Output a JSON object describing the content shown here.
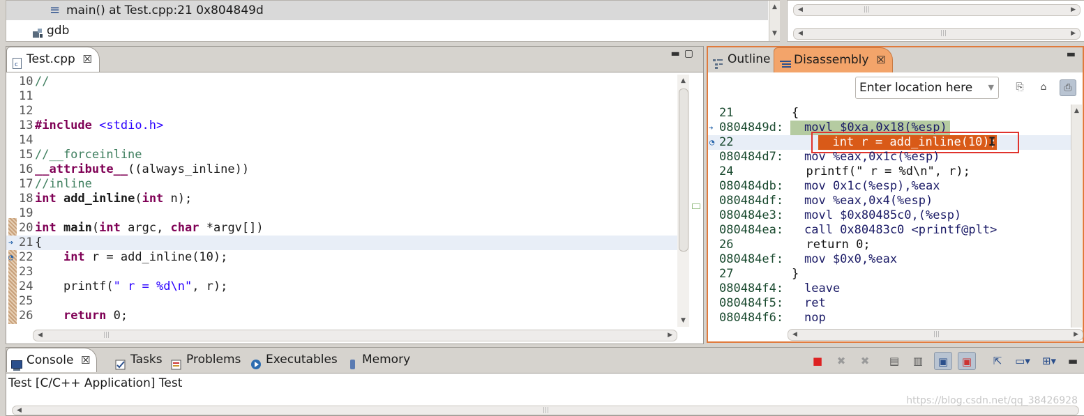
{
  "debug": {
    "stack_frame": "main() at Test.cpp:21 0x804849d",
    "process": "gdb"
  },
  "editor": {
    "tab_label": "Test.cpp",
    "lines": [
      {
        "num": "10",
        "segs": [
          {
            "t": "//",
            "c": "cm"
          }
        ]
      },
      {
        "num": "11",
        "segs": []
      },
      {
        "num": "12",
        "segs": []
      },
      {
        "num": "13",
        "segs": [
          {
            "t": "#include",
            "c": "pp"
          },
          {
            "t": " ",
            "c": ""
          },
          {
            "t": "<stdio.h>",
            "c": "inc"
          }
        ]
      },
      {
        "num": "14",
        "segs": []
      },
      {
        "num": "15",
        "segs": [
          {
            "t": "//__forceinline",
            "c": "cm"
          }
        ]
      },
      {
        "num": "16",
        "segs": [
          {
            "t": "__attribute__",
            "c": "kw"
          },
          {
            "t": "((always_inline))",
            "c": ""
          }
        ]
      },
      {
        "num": "17",
        "segs": [
          {
            "t": "//inline",
            "c": "cm"
          }
        ]
      },
      {
        "num": "18",
        "segs": [
          {
            "t": "int",
            "c": "kw"
          },
          {
            "t": " ",
            "c": ""
          },
          {
            "t": "add_inline",
            "c": "b"
          },
          {
            "t": "(",
            "c": ""
          },
          {
            "t": "int",
            "c": "kw"
          },
          {
            "t": " n);",
            "c": ""
          }
        ]
      },
      {
        "num": "19",
        "segs": []
      },
      {
        "num": "20",
        "segs": [
          {
            "t": "int",
            "c": "kw"
          },
          {
            "t": " ",
            "c": ""
          },
          {
            "t": "main",
            "c": "b"
          },
          {
            "t": "(",
            "c": ""
          },
          {
            "t": "int",
            "c": "kw"
          },
          {
            "t": " argc, ",
            "c": ""
          },
          {
            "t": "char",
            "c": "kw"
          },
          {
            "t": " *argv[])",
            "c": ""
          }
        ]
      },
      {
        "num": "21",
        "segs": [
          {
            "t": "{",
            "c": ""
          }
        ],
        "hl": true
      },
      {
        "num": "22",
        "segs": [
          {
            "t": "    ",
            "c": ""
          },
          {
            "t": "int",
            "c": "kw"
          },
          {
            "t": " r = add_inline(10);",
            "c": ""
          }
        ]
      },
      {
        "num": "23",
        "segs": []
      },
      {
        "num": "24",
        "segs": [
          {
            "t": "    printf(",
            "c": ""
          },
          {
            "t": "\" r = %d\\n\"",
            "c": "str"
          },
          {
            "t": ", r);",
            "c": ""
          }
        ]
      },
      {
        "num": "25",
        "segs": []
      },
      {
        "num": "26",
        "segs": [
          {
            "t": "    ",
            "c": ""
          },
          {
            "t": "return",
            "c": "kw"
          },
          {
            "t": " 0;",
            "c": ""
          }
        ]
      }
    ]
  },
  "disassembly": {
    "tabs": [
      "Outline",
      "Disassembly"
    ],
    "location_placeholder": "Enter location here",
    "rows": [
      {
        "addr": "21",
        "src": "{"
      },
      {
        "addr": "0804849d:",
        "ins": "movl $0xa,0x18(%esp)",
        "mark": "green"
      },
      {
        "addr": "22",
        "src": "  int r = add_inline(10);",
        "mark": "orange",
        "hl": true
      },
      {
        "addr": "080484d7:",
        "ins": "mov %eax,0x1c(%esp)"
      },
      {
        "addr": "24",
        "src": "  printf(\" r = %d\\n\", r);"
      },
      {
        "addr": "080484db:",
        "ins": "mov 0x1c(%esp),%eax"
      },
      {
        "addr": "080484df:",
        "ins": "mov %eax,0x4(%esp)"
      },
      {
        "addr": "080484e3:",
        "ins": "movl $0x80485c0,(%esp)"
      },
      {
        "addr": "080484ea:",
        "ins": "call 0x80483c0 <printf@plt>"
      },
      {
        "addr": "26",
        "src": "  return 0;"
      },
      {
        "addr": "080484ef:",
        "ins": "mov $0x0,%eax"
      },
      {
        "addr": "27",
        "src": "}"
      },
      {
        "addr": "080484f4:",
        "ins": "leave"
      },
      {
        "addr": "080484f5:",
        "ins": "ret"
      },
      {
        "addr": "080484f6:",
        "ins": "nop"
      }
    ]
  },
  "console": {
    "tabs": [
      "Console",
      "Tasks",
      "Problems",
      "Executables",
      "Memory"
    ],
    "text": "Test [C/C++ Application] Test",
    "watermark": "https://blog.csdn.net/qq_38426928"
  },
  "colors": {
    "accent_orange": "#e07a3c",
    "current_line": "#e8eef7",
    "selection_orange": "#d95a18"
  }
}
